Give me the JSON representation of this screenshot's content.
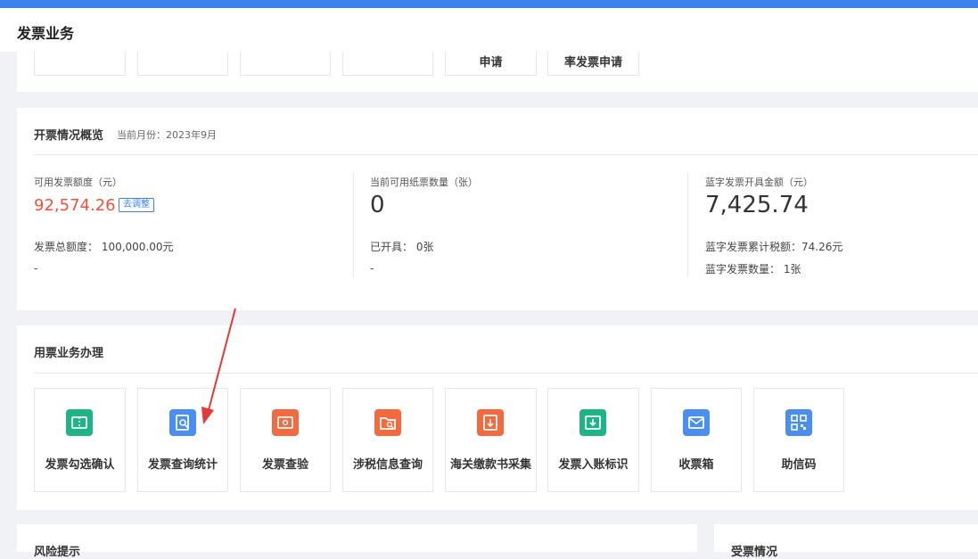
{
  "header": {
    "title": "发票业务"
  },
  "top_cards": [
    {
      "label": ""
    },
    {
      "label": ""
    },
    {
      "label": ""
    },
    {
      "label": ""
    },
    {
      "label": "申请"
    },
    {
      "label": "率发票申请"
    }
  ],
  "overview": {
    "title": "开票情况概览",
    "month_note": "当前月份：2023年9月",
    "available_quota": {
      "label": "可用发票额度（元）",
      "value": "92,574.26",
      "adjust_label": "去调整",
      "total_line": "发票总额度： 100,000.00元",
      "extra": "-"
    },
    "paper_invoices": {
      "label": "当前可用纸票数量（张）",
      "value": "0",
      "issued_line": "已开具： 0张",
      "extra": "-"
    },
    "blue_invoice": {
      "label": "蓝字发票开具金额（元）",
      "value": "7,425.74",
      "tax_line": "蓝字发票累计税额：74.26元",
      "count_line": "蓝字发票数量： 1张"
    }
  },
  "business": {
    "title": "用票业务办理",
    "items": [
      {
        "label": "发票勾选确认",
        "icon": "ticket-icon",
        "color": "#1fb386"
      },
      {
        "label": "发票查询统计",
        "icon": "doc-search-icon",
        "color": "#4a8ff0"
      },
      {
        "label": "发票查验",
        "icon": "ticket-check-icon",
        "color": "#f26a3d"
      },
      {
        "label": "涉税信息查询",
        "icon": "folder-search-icon",
        "color": "#f26a3d"
      },
      {
        "label": "海关缴款书采集",
        "icon": "doc-download-icon",
        "color": "#f26a3d"
      },
      {
        "label": "发票入账标识",
        "icon": "inbox-icon",
        "color": "#1fb386"
      },
      {
        "label": "收票箱",
        "icon": "mail-icon",
        "color": "#4a8ff0"
      },
      {
        "label": "助信码",
        "icon": "qr-code-icon",
        "color": "#4a8ff0"
      }
    ]
  },
  "bottom": {
    "risk_title": "风险提示",
    "receive_title": "受票情况"
  }
}
